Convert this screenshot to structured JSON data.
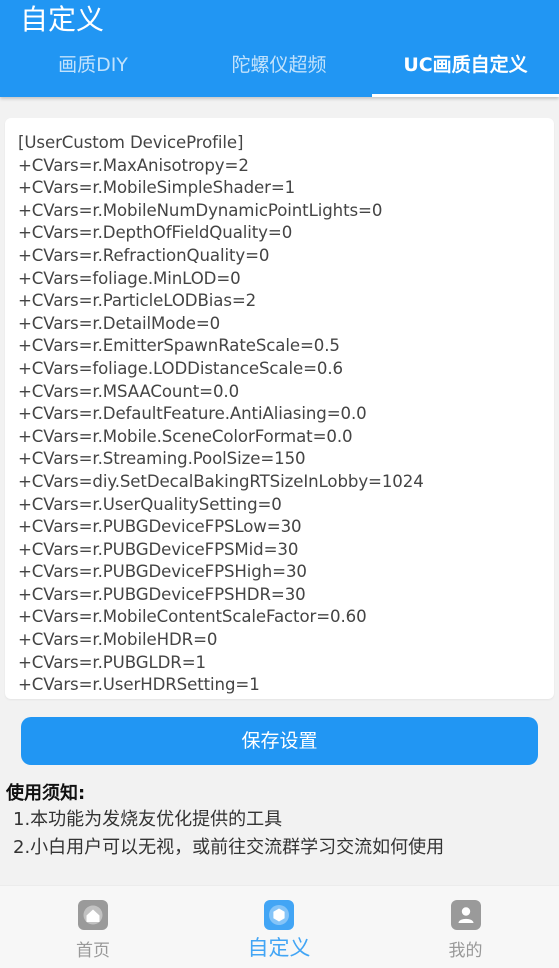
{
  "header": {
    "title": "自定义",
    "tabs": [
      {
        "label": "画质DIY"
      },
      {
        "label": "陀螺仪超频"
      },
      {
        "label": "UC画质自定义"
      }
    ],
    "active_tab": 2
  },
  "editor": {
    "lines": [
      "[UserCustom DeviceProfile]",
      "+CVars=r.MaxAnisotropy=2",
      "+CVars=r.MobileSimpleShader=1",
      "+CVars=r.MobileNumDynamicPointLights=0",
      "+CVars=r.DepthOfFieldQuality=0",
      "+CVars=r.RefractionQuality=0",
      "+CVars=foliage.MinLOD=0",
      "+CVars=r.ParticleLODBias=2",
      "+CVars=r.DetailMode=0",
      "+CVars=r.EmitterSpawnRateScale=0.5",
      "+CVars=foliage.LODDistanceScale=0.6",
      "+CVars=r.MSAACount=0.0",
      "+CVars=r.DefaultFeature.AntiAliasing=0.0",
      "+CVars=r.Mobile.SceneColorFormat=0.0",
      "+CVars=r.Streaming.PoolSize=150",
      "+CVars=diy.SetDecalBakingRTSizeInLobby=1024",
      "+CVars=r.UserQualitySetting=0",
      "+CVars=r.PUBGDeviceFPSLow=30",
      "+CVars=r.PUBGDeviceFPSMid=30",
      "+CVars=r.PUBGDeviceFPSHigh=30",
      "+CVars=r.PUBGDeviceFPSHDR=30",
      "+CVars=r.MobileContentScaleFactor=0.60",
      "+CVars=r.MobileHDR=0",
      "+CVars=r.PUBGLDR=1",
      "+CVars=r.UserHDRSetting=1"
    ]
  },
  "save_button": {
    "label": "保存设置"
  },
  "notice": {
    "title": "使用须知:",
    "items": [
      "1.本功能为发烧友优化提供的工具",
      "2.小白用户可以无视，或前往交流群学习交流如何使用"
    ]
  },
  "bottom_nav": {
    "items": [
      {
        "label": "首页",
        "icon": "home-icon"
      },
      {
        "label": "自定义",
        "icon": "customize-icon"
      },
      {
        "label": "我的",
        "icon": "profile-icon"
      }
    ],
    "active_index": 1
  },
  "colors": {
    "primary": "#2196f3",
    "accent": "#42a5f5",
    "inactive": "#999999"
  }
}
